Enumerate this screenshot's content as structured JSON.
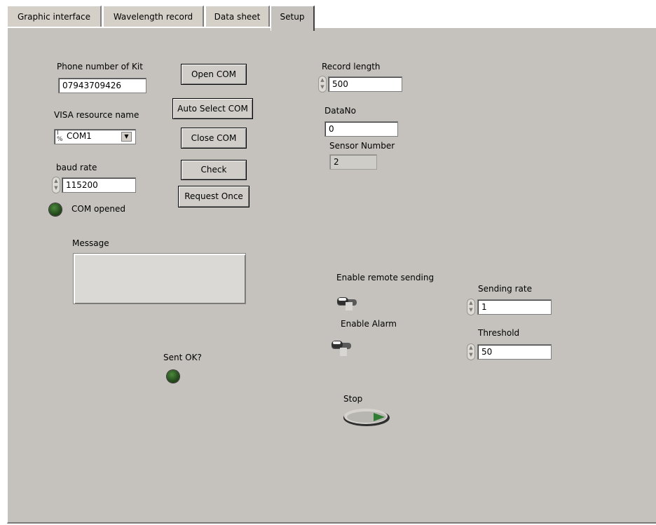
{
  "tabs": [
    {
      "label": "Graphic interface"
    },
    {
      "label": "Wavelength record"
    },
    {
      "label": "Data sheet"
    },
    {
      "label": "Setup"
    }
  ],
  "active_tab": "Setup",
  "com": {
    "phone_label": "Phone number of Kit",
    "phone_value": "07943709426",
    "visa_label": "VISA resource name",
    "visa_value": "COM1",
    "visa_prefix_glyph": "I/O",
    "baud_label": "baud rate",
    "baud_value": "115200",
    "com_led_label": "COM opened"
  },
  "buttons": {
    "open_com": "Open COM",
    "auto_select_com": "Auto Select COM",
    "close_com": "Close COM",
    "check": "Check",
    "request_once": "Request Once"
  },
  "record": {
    "length_label": "Record length",
    "length_value": "500",
    "datano_label": "DataNo",
    "datano_value": "0",
    "sensor_label": "Sensor Number",
    "sensor_value": "2"
  },
  "message": {
    "label": "Message",
    "value": ""
  },
  "sent_ok_label": "Sent OK?",
  "remote": {
    "enable_remote_label": "Enable remote sending",
    "enable_alarm_label": "Enable Alarm",
    "sending_rate_label": "Sending rate",
    "sending_rate_value": "1",
    "threshold_label": "Threshold",
    "threshold_value": "50"
  },
  "stop_label": "Stop",
  "colors": {
    "panel": "#c5c2bd",
    "led_off": "#2c5423"
  }
}
